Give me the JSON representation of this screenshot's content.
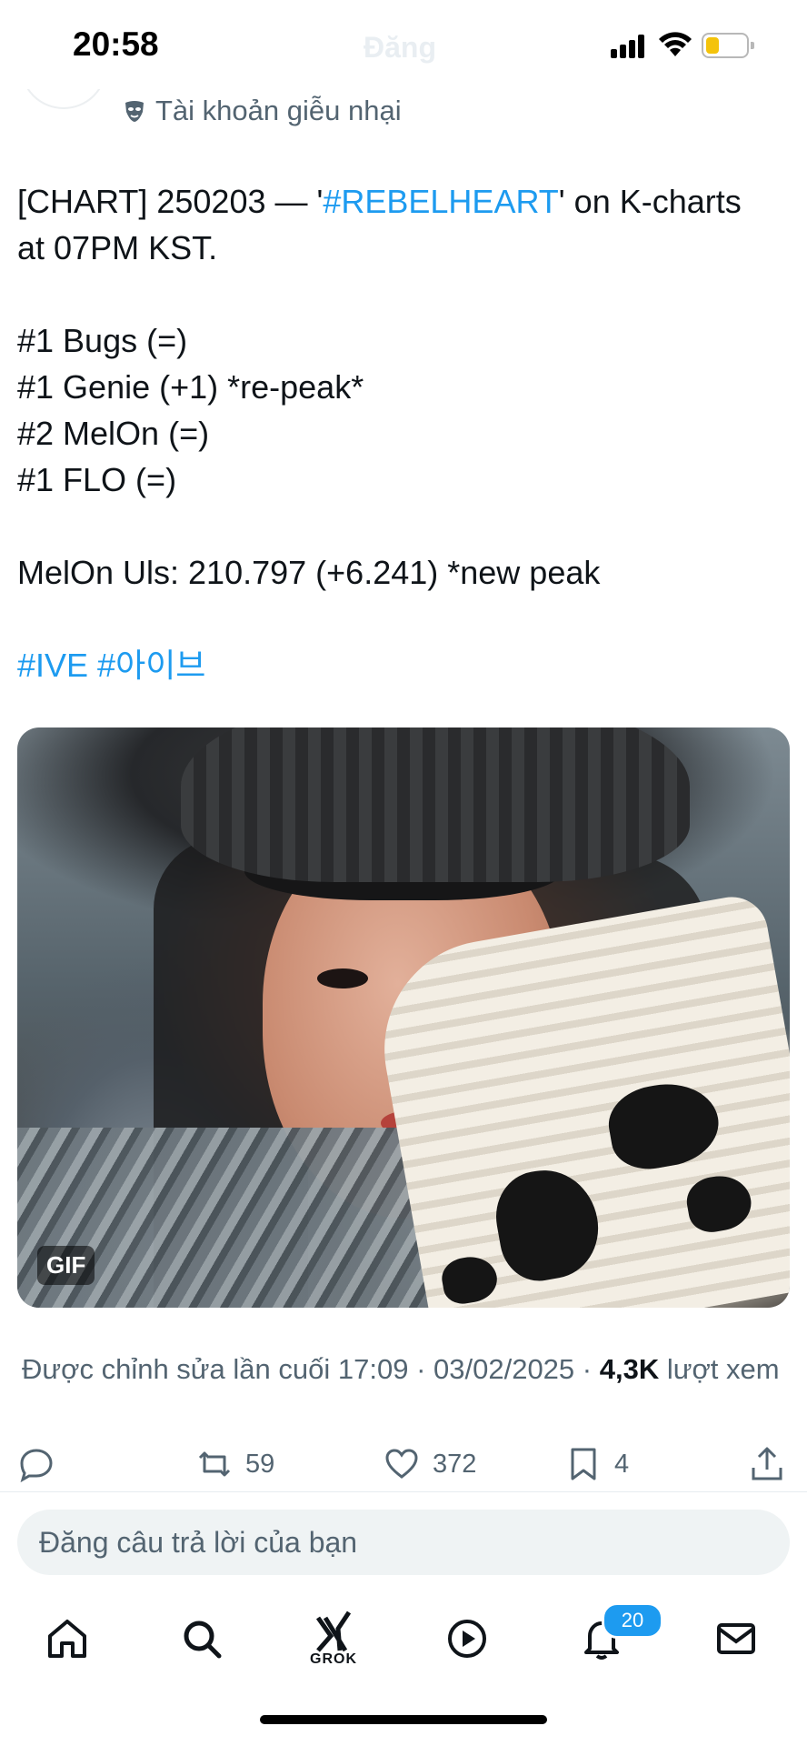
{
  "status_bar": {
    "time": "20:58",
    "ghost_title": "Đăng"
  },
  "tweet": {
    "parody_label": "Tài khoản giễu nhại",
    "lines": [
      [
        "[CHART] 250203 — '",
        "#REBELHEART",
        "' on K-charts"
      ],
      "at 07PM KST.",
      "#1 Bugs (=)",
      "#1 Genie (+1) *re-peak*",
      "#2 MelOn (=)",
      "#1 FLO (=)",
      "MelOn Uls: 210.797 (+6.241) *new peak",
      "#IVE #아이브"
    ],
    "line0_part0": "[CHART] 250203 — '",
    "hashtag_rebelheart": "#REBELHEART",
    "line0_part2": "' on K-charts",
    "line1": "at 07PM KST.",
    "bugs": "#1 Bugs (=)",
    "genie": "#1 Genie (+1) *re-peak*",
    "melon": "#2 MelOn (=)",
    "flo": "#1 FLO (=)",
    "melon_uls": "MelOn Uls: 210.797 (+6.241) *new peak",
    "hashtags": "#IVE #아이브",
    "media_badge": "GIF",
    "edited_label": "Được chỉnh sửa lần cuối",
    "edited_time": "17:09 · 03/02/2025",
    "views_count": "4,3K",
    "views_label": "lượt xem"
  },
  "actions": {
    "reply_icon": "reply-icon",
    "retweet_count": "59",
    "like_count": "372",
    "bookmark_count": "4"
  },
  "reply_box": {
    "placeholder": "Đăng câu trả lời của bạn"
  },
  "tabbar": {
    "grok_label": "GROK",
    "notifications_badge": "20"
  },
  "colors": {
    "accent": "#1d9bf0",
    "text_secondary": "#536471",
    "text_primary": "#0f1419"
  }
}
